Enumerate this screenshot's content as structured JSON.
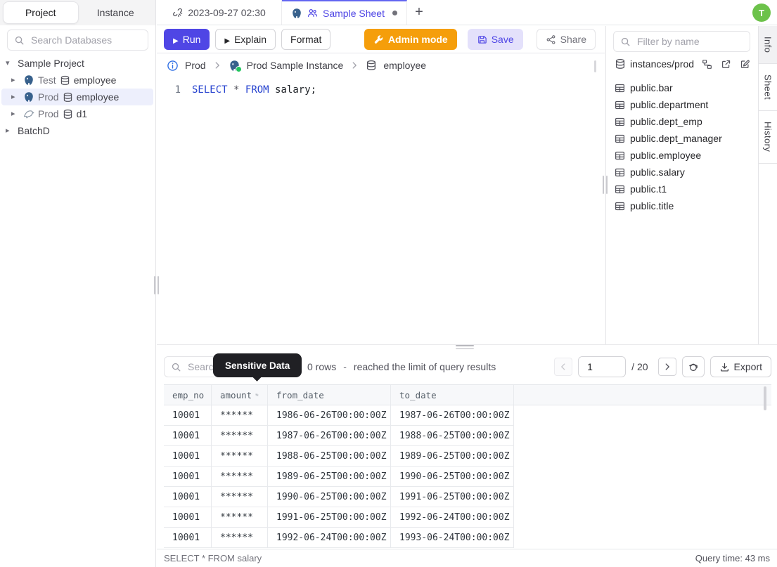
{
  "user": {
    "initial": "T"
  },
  "colors": {
    "accent": "#4f46e5",
    "tab_active_border": "#6366f1",
    "admin_orange": "#f59e0b",
    "save_bg": "#e4e1fb",
    "avatar_green": "#6cc24a",
    "tooltip_bg": "#202024",
    "selected_row_bg": "#edeffc",
    "sql_keyword_blue": "#2743cf"
  },
  "icon_names": [
    "search-icon",
    "unlink-icon",
    "postgres-icon",
    "mysql-icon",
    "team-icon",
    "add-tab-icon",
    "play-icon",
    "wrench-icon",
    "save-icon",
    "share-icon",
    "info-icon",
    "chevron-right-icon",
    "chevron-left-icon",
    "database-icon",
    "table-icon",
    "schema-diagram-icon",
    "external-link-icon",
    "edit-icon",
    "eye-slash-icon",
    "masking-icon",
    "download-icon",
    "dirty-dot",
    "tree-expand-icon",
    "tree-collapse-icon"
  ],
  "sidebar": {
    "tabs": {
      "project": "Project",
      "instance": "Instance"
    },
    "search_placeholder": "Search Databases",
    "project_label": "Sample Project",
    "tree": [
      {
        "env": "Test",
        "db": "employee",
        "engine": "postgres"
      },
      {
        "env": "Prod",
        "db": "employee",
        "engine": "postgres",
        "selected": true
      },
      {
        "env": "Prod",
        "db": "d1",
        "engine": "mysql"
      }
    ],
    "batch_label": "BatchD"
  },
  "editor_tabs": {
    "time_tab": "2023-09-27 02:30",
    "sheet_tab": "Sample Sheet"
  },
  "toolbar": {
    "run": "Run",
    "explain": "Explain",
    "format": "Format",
    "admin_mode": "Admin mode",
    "save": "Save",
    "share": "Share"
  },
  "breadcrumb": {
    "env": "Prod",
    "instance": "Prod Sample Instance",
    "database": "employee"
  },
  "editor": {
    "line_no": "1",
    "kw_select": "SELECT",
    "star": "*",
    "kw_from": "FROM",
    "tail": "salary;"
  },
  "connection_panel": {
    "filter_placeholder": "Filter by name",
    "source": "instances/prod",
    "tables": [
      "public.bar",
      "public.department",
      "public.dept_emp",
      "public.dept_manager",
      "public.employee",
      "public.salary",
      "public.t1",
      "public.title"
    ]
  },
  "side_tabs": [
    "Info",
    "Sheet",
    "History"
  ],
  "results": {
    "search_placeholder": "Search",
    "tooltip": "Sensitive Data",
    "rows_count": "0 rows",
    "dash": "-",
    "limit_note": "reached the limit of query results",
    "page": "1",
    "page_total": "/ 20",
    "export_label": "Export",
    "table": {
      "columns": [
        "emp_no",
        "amount",
        "from_date",
        "to_date"
      ],
      "masked_column": "amount",
      "rows": [
        [
          "10001",
          "******",
          "1986-06-26T00:00:00Z",
          "1987-06-26T00:00:00Z"
        ],
        [
          "10001",
          "******",
          "1987-06-26T00:00:00Z",
          "1988-06-25T00:00:00Z"
        ],
        [
          "10001",
          "******",
          "1988-06-25T00:00:00Z",
          "1989-06-25T00:00:00Z"
        ],
        [
          "10001",
          "******",
          "1989-06-25T00:00:00Z",
          "1990-06-25T00:00:00Z"
        ],
        [
          "10001",
          "******",
          "1990-06-25T00:00:00Z",
          "1991-06-25T00:00:00Z"
        ],
        [
          "10001",
          "******",
          "1991-06-25T00:00:00Z",
          "1992-06-24T00:00:00Z"
        ],
        [
          "10001",
          "******",
          "1992-06-24T00:00:00Z",
          "1993-06-24T00:00:00Z"
        ]
      ]
    },
    "status_sql": "SELECT * FROM salary",
    "query_time": "Query time: 43 ms"
  }
}
